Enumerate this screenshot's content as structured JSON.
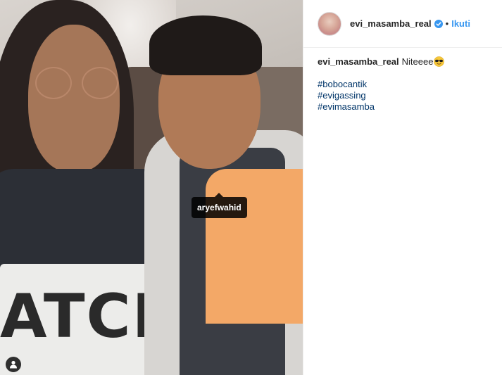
{
  "post": {
    "user_tag": "aryefwahid",
    "shirt_text": "ATCHE"
  },
  "header": {
    "username": "evi_masamba_real",
    "separator": "•",
    "follow_label": "Ikuti"
  },
  "caption": {
    "username": "evi_masamba_real",
    "text": "Niteeee",
    "emoji": "sunglasses-emoji"
  },
  "hashtags": [
    "#bobocantik",
    "#evigassing",
    "#evimasamba"
  ],
  "colors": {
    "link_blue": "#3897f0",
    "hashtag_blue": "#003569",
    "verified_blue": "#3897f0",
    "tag_bg": "#000000"
  }
}
